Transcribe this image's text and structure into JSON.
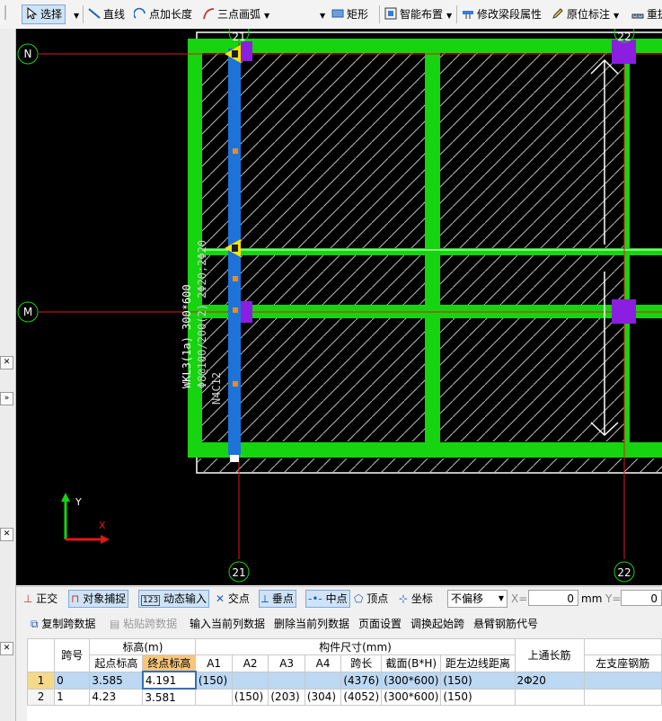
{
  "toolbar": {
    "select": "选择",
    "line": "直线",
    "point_length": "点加长度",
    "three_point_arc": "三点画弧",
    "rect": "矩形",
    "smart_layout": "智能布置",
    "edit_span_props": "修改梁段属性",
    "in_place_mark": "原位标注",
    "re_extract": "重提"
  },
  "canvas": {
    "axis_labels": {
      "top_left": "21",
      "top_right": "22",
      "bottom_left": "21",
      "bottom_right": "22",
      "row_n": "N",
      "row_m": "M"
    },
    "beam_text": "WKL3(1a) 300*600",
    "beam_text_2": "Φ8@100/200(2)",
    "beam_text_3": "2Φ20;2Φ20",
    "beam_text_4": "N4C12",
    "ucs": {
      "y": "Y",
      "x": "X"
    },
    "colors": {
      "background": "#000000",
      "wall": "#16d40f",
      "beam": "#1e73d8",
      "column": "#8b1ee0",
      "axis": "#e01818"
    }
  },
  "snapbar": {
    "ortho": "正交",
    "object_snap": "对象捕捉",
    "dynamic_input": "动态输入",
    "intersection": "交点",
    "perpendicular": "垂点",
    "midpoint": "中点",
    "vertex": "顶点",
    "coordinate": "坐标",
    "offset": "不偏移",
    "x_label": "X=",
    "x_value": "0",
    "unit": "mm",
    "y_label": "Y=",
    "y_value": "0"
  },
  "datatools": {
    "copy_span": "复制跨数据",
    "paste_span": "粘贴跨数据",
    "input_col": "输入当前列数据",
    "delete_col": "删除当前列数据",
    "page_setup": "页面设置",
    "swap_start": "调换起始跨",
    "cantilever_code": "悬臂钢筋代号"
  },
  "table": {
    "headers": {
      "span_no": "跨号",
      "elevation": "标高(m)",
      "start_elev": "起点标高",
      "end_elev": "终点标高",
      "dims": "构件尺寸(mm)",
      "a1": "A1",
      "a2": "A2",
      "a3": "A3",
      "a4": "A4",
      "span_len": "跨长",
      "section": "截面(B*H)",
      "edge_dist": "距左边线距离",
      "top_rebar": "上通长筋",
      "left_support": "左支座钢筋"
    },
    "rows": [
      {
        "idx": "1",
        "span": "0",
        "start": "3.585",
        "end": "4.191",
        "a1": "(150)",
        "a2": "",
        "a3": "",
        "a4": "",
        "len": "(4376)",
        "sec": "(300*600)",
        "edge": "(150)",
        "top": "2Φ20",
        "left": ""
      },
      {
        "idx": "2",
        "span": "1",
        "start": "4.23",
        "end": "3.581",
        "a1": "",
        "a2": "(150)",
        "a3": "(203)",
        "a4": "(304)",
        "len": "(4052)",
        "sec": "(300*600)",
        "edge": "(150)",
        "top": "",
        "left": ""
      }
    ]
  }
}
